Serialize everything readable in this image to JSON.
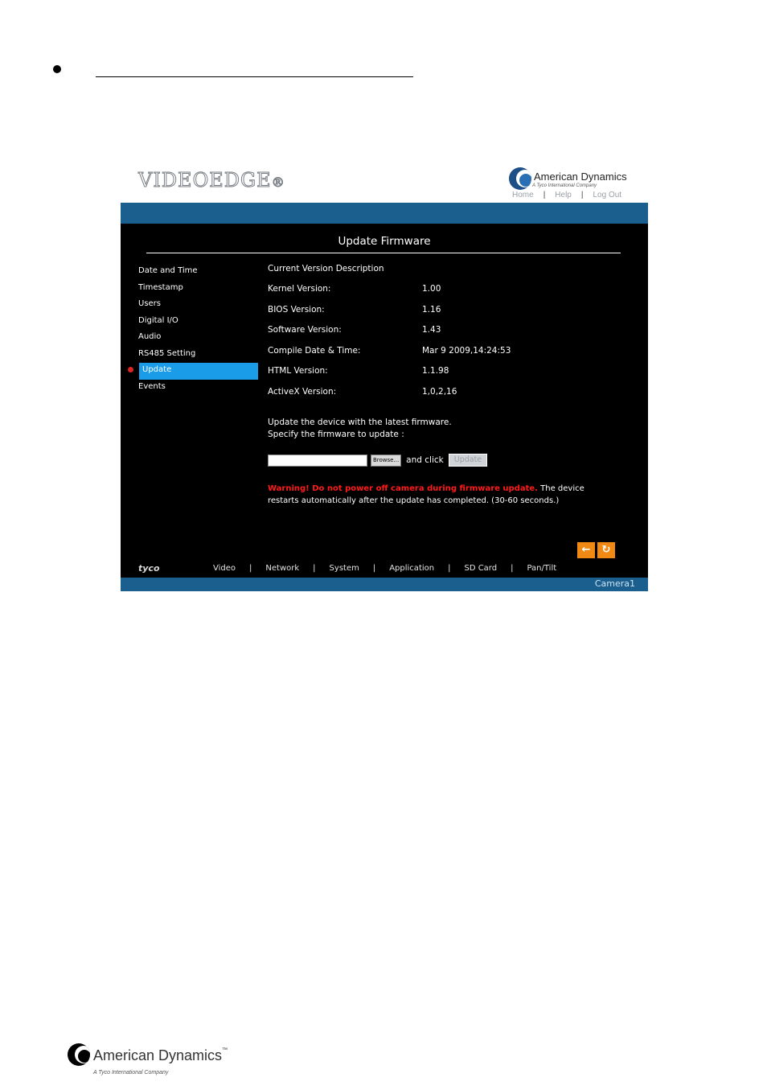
{
  "header": {
    "brand": "VIDEOEDGE",
    "brand_mark": "®",
    "company": "American Dynamics",
    "company_sub": "A Tyco International Company",
    "links": [
      "Home",
      "Help",
      "Log Out"
    ]
  },
  "page": {
    "title": "Update Firmware"
  },
  "menu": {
    "items": [
      "Date and Time",
      "Timestamp",
      "Users",
      "Digital I/O",
      "Audio",
      "RS485 Setting",
      "Update",
      "Events"
    ],
    "active": "Update"
  },
  "content": {
    "section_head": "Current Version Description",
    "rows": [
      {
        "k": "Kernel Version:",
        "v": "1.00"
      },
      {
        "k": "BIOS Version:",
        "v": "1.16"
      },
      {
        "k": "Software Version:",
        "v": "1.43"
      },
      {
        "k": "Compile Date & Time:",
        "v": "Mar 9 2009,14:24:53"
      },
      {
        "k": "HTML Version:",
        "v": "1.1.98"
      },
      {
        "k": "ActiveX Version:",
        "v": "1,0,2,16"
      }
    ],
    "instr1": "Update the device with the latest firmware.",
    "instr2": "Specify the firmware to update :",
    "browse": "Browse...",
    "and_click": "and click",
    "update_btn": "Update",
    "warning_red": "Warning! Do not power off camera during firmware update.",
    "warning_rest": " The device restarts automatically after the update has completed. (30-60 seconds.)"
  },
  "footer_nav": {
    "brand": "tyco",
    "items": [
      "Video",
      "Network",
      "System",
      "Application",
      "SD Card",
      "Pan/Tilt"
    ],
    "camera": "Camera1"
  },
  "doc_footer": {
    "company": "American Dynamics",
    "tm": "™",
    "sub": "A Tyco International Company"
  }
}
